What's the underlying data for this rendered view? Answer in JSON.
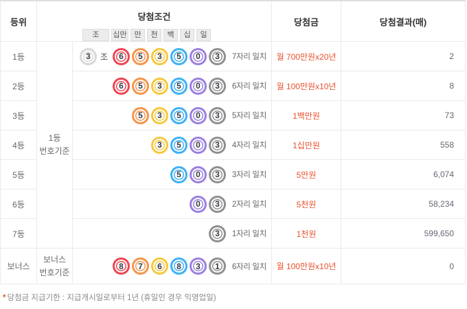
{
  "table": {
    "headers": {
      "rank": "등위",
      "condition": "당첨조건",
      "prize": "당첨금",
      "result": "당첨결과(매)"
    },
    "positions": [
      "조",
      "십만",
      "만",
      "천",
      "백",
      "십",
      "일"
    ],
    "group": {
      "line1": "1등",
      "line2": "번호기준"
    },
    "rows": [
      {
        "rank": "1등",
        "jo": "3",
        "jo_label": "조",
        "numbers": [
          "6",
          "5",
          "3",
          "5",
          "0",
          "3"
        ],
        "match": "7자리 일치",
        "prize": "월 700만원x20년",
        "result": "2"
      },
      {
        "rank": "2등",
        "numbers": [
          "6",
          "5",
          "3",
          "5",
          "0",
          "3"
        ],
        "match": "6자리 일치",
        "prize": "월 100만원x10년",
        "result": "8"
      },
      {
        "rank": "3등",
        "numbers": [
          "5",
          "3",
          "5",
          "0",
          "3"
        ],
        "match": "5자리 일치",
        "prize": "1백만원",
        "result": "73"
      },
      {
        "rank": "4등",
        "numbers": [
          "3",
          "5",
          "0",
          "3"
        ],
        "match": "4자리 일치",
        "prize": "1십만원",
        "result": "558"
      },
      {
        "rank": "5등",
        "numbers": [
          "5",
          "0",
          "3"
        ],
        "match": "3자리 일치",
        "prize": "5만원",
        "result": "6,074"
      },
      {
        "rank": "6등",
        "numbers": [
          "0",
          "3"
        ],
        "match": "2자리 일치",
        "prize": "5천원",
        "result": "58,234"
      },
      {
        "rank": "7등",
        "numbers": [
          "3"
        ],
        "match": "1자리 일치",
        "prize": "1천원",
        "result": "599,650"
      }
    ],
    "bonus": {
      "rank": "보너스",
      "group_line1": "보너스",
      "group_line2": "번호기준",
      "numbers": [
        "8",
        "7",
        "6",
        "8",
        "3",
        "1"
      ],
      "match": "6자리 일치",
      "prize": "월 100만원x10년",
      "result": "0"
    }
  },
  "ball_colors": [
    "#d8d8d8",
    "#ee4552",
    "#f6954c",
    "#f5c83e",
    "#3fb2f2",
    "#9b80de",
    "#909090"
  ],
  "accent": {
    "prize_text": "#e8512c",
    "header_bg": "#f6f6f6"
  },
  "footnote": {
    "marker": "*",
    "text": "당첨금 지급기한 : 지급개시일로부터 1년 (휴일인 경우 익영업일)"
  }
}
